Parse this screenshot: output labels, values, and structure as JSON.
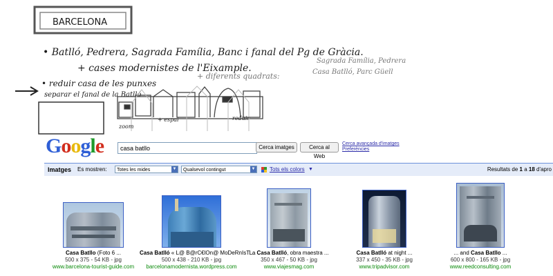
{
  "sketch": {
    "title": "BARCELONA",
    "line1": "• Batlló, Pedrera, Sagrada Família, Banc i fanal del Pg de Gràcia.",
    "line2": "+ cases modernistes de l'Eixample.",
    "line3": "+ diferents quadrats:",
    "side_note_1": "Sagrada Família, Pedrera",
    "side_note_2": "Casa Batlló, Parc Güell",
    "line4": "• reduir casa de les punxes",
    "line5": "separar el fanal de la Batlló",
    "label_1": "zoom",
    "label_2": "+ espai",
    "label_3": "reduir"
  },
  "google": {
    "logo_letters": [
      "G",
      "o",
      "o",
      "g",
      "l",
      "e"
    ],
    "logo_colors": [
      "#2f5fd6",
      "#d22e1e",
      "#e8b90e",
      "#2f5fd6",
      "#1e9a2a",
      "#d22e1e"
    ],
    "search_value": "casa batllo",
    "btn_images": "Cerca imatges",
    "btn_web": "Cerca al Web",
    "advanced_images": "Cerca avançada d'imatges",
    "preferences": "Preferències"
  },
  "toolbar": {
    "title": "Imatges",
    "show_label": "Es mostren:",
    "size_select": "Totes les mides",
    "content_select": "Qualsevol contingut",
    "colors_link": "Tots els colors",
    "results_prefix": "Resultats de ",
    "results_from": "1",
    "results_mid": " a ",
    "results_to": "18",
    "results_suffix": " d'apro"
  },
  "results": [
    {
      "title_bold": "Casa Batllo",
      "title_rest": " (Foto 6 ...",
      "meta": "500 x 375 - 54 KB - jpg",
      "site": "www.barcelona-tourist-guide.com"
    },
    {
      "title_bold": "Casa Batlló",
      "title_rest": " « L@ B@rC€lOn@ MoDeRnIsT ...",
      "meta": "500 x 438 - 210 KB - jpg",
      "site": "barcelonamodernista.wordpress.com"
    },
    {
      "title_pre": "La ",
      "title_bold": "Casa Batlló",
      "title_rest": ", obra maestra ...",
      "meta": "350 x 467 - 50 KB - jpg",
      "site": "www.viajesmag.com"
    },
    {
      "title_bold": "Casa Batlló",
      "title_rest": " at night ...",
      "meta": "337 x 450 - 35 KB - jpg",
      "site": "www.tripadvisor.com"
    },
    {
      "title_pre": "... and ",
      "title_bold": "Casa Batllo",
      "title_rest": " ...",
      "meta": "600 x 800 - 165 KB - jpg",
      "site": "www.reedconsulting.com"
    }
  ]
}
